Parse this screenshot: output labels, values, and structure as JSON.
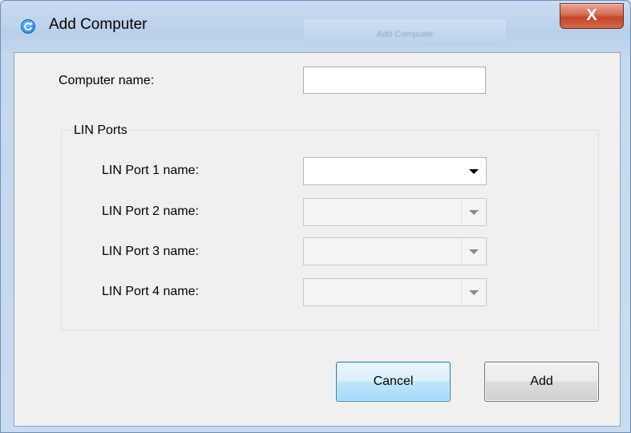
{
  "window": {
    "title": "Add Computer",
    "background_tab_label": "Add Computer",
    "close_glyph": "X"
  },
  "form": {
    "computer_name_label": "Computer name:",
    "computer_name_value": "",
    "lin_ports_group_label": "LIN Ports",
    "lin_ports": [
      {
        "label": "LIN Port 1 name:",
        "value": "",
        "enabled": true
      },
      {
        "label": "LIN Port 2 name:",
        "value": "",
        "enabled": false
      },
      {
        "label": "LIN Port 3 name:",
        "value": "",
        "enabled": false
      },
      {
        "label": "LIN Port 4 name:",
        "value": "",
        "enabled": false
      }
    ]
  },
  "buttons": {
    "cancel_label": "Cancel",
    "add_label": "Add"
  },
  "colors": {
    "close_button": "#c6442a",
    "focused_button_border": "#3c7fb1",
    "client_background": "#f0f0f0"
  }
}
